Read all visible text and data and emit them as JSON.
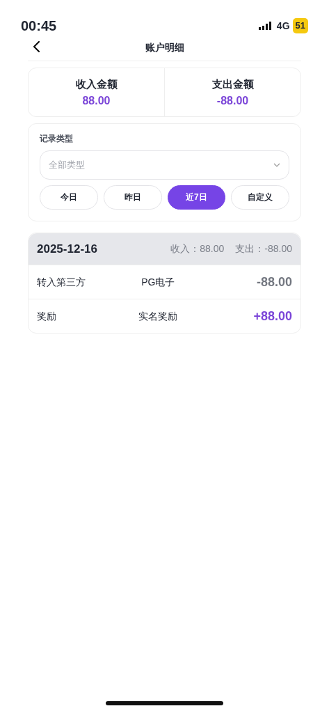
{
  "status_bar": {
    "time": "00:45",
    "network": "4G",
    "battery": "51"
  },
  "header": {
    "title": "账户明细"
  },
  "summary": [
    {
      "label": "收入金额",
      "amount": "88.00"
    },
    {
      "label": "支出金额",
      "amount": "-88.00"
    }
  ],
  "filter": {
    "label": "记录类型",
    "select": {
      "placeholder": "全部类型"
    },
    "periods": [
      {
        "label": "今日",
        "selected": false
      },
      {
        "label": "昨日",
        "selected": false
      },
      {
        "label": "近7日",
        "selected": true
      },
      {
        "label": "自定义",
        "selected": false
      }
    ]
  },
  "groups": [
    {
      "date": "2025-12-16",
      "income": "收入：88.00",
      "expense": "支出：-88.00",
      "rows": [
        {
          "kind": "expense",
          "type": "转入第三方",
          "detail": "PG电子",
          "amount": "-88.00"
        },
        {
          "kind": "income",
          "type": "奖励",
          "detail": "实名奖励",
          "amount": "+88.00"
        }
      ]
    }
  ]
}
